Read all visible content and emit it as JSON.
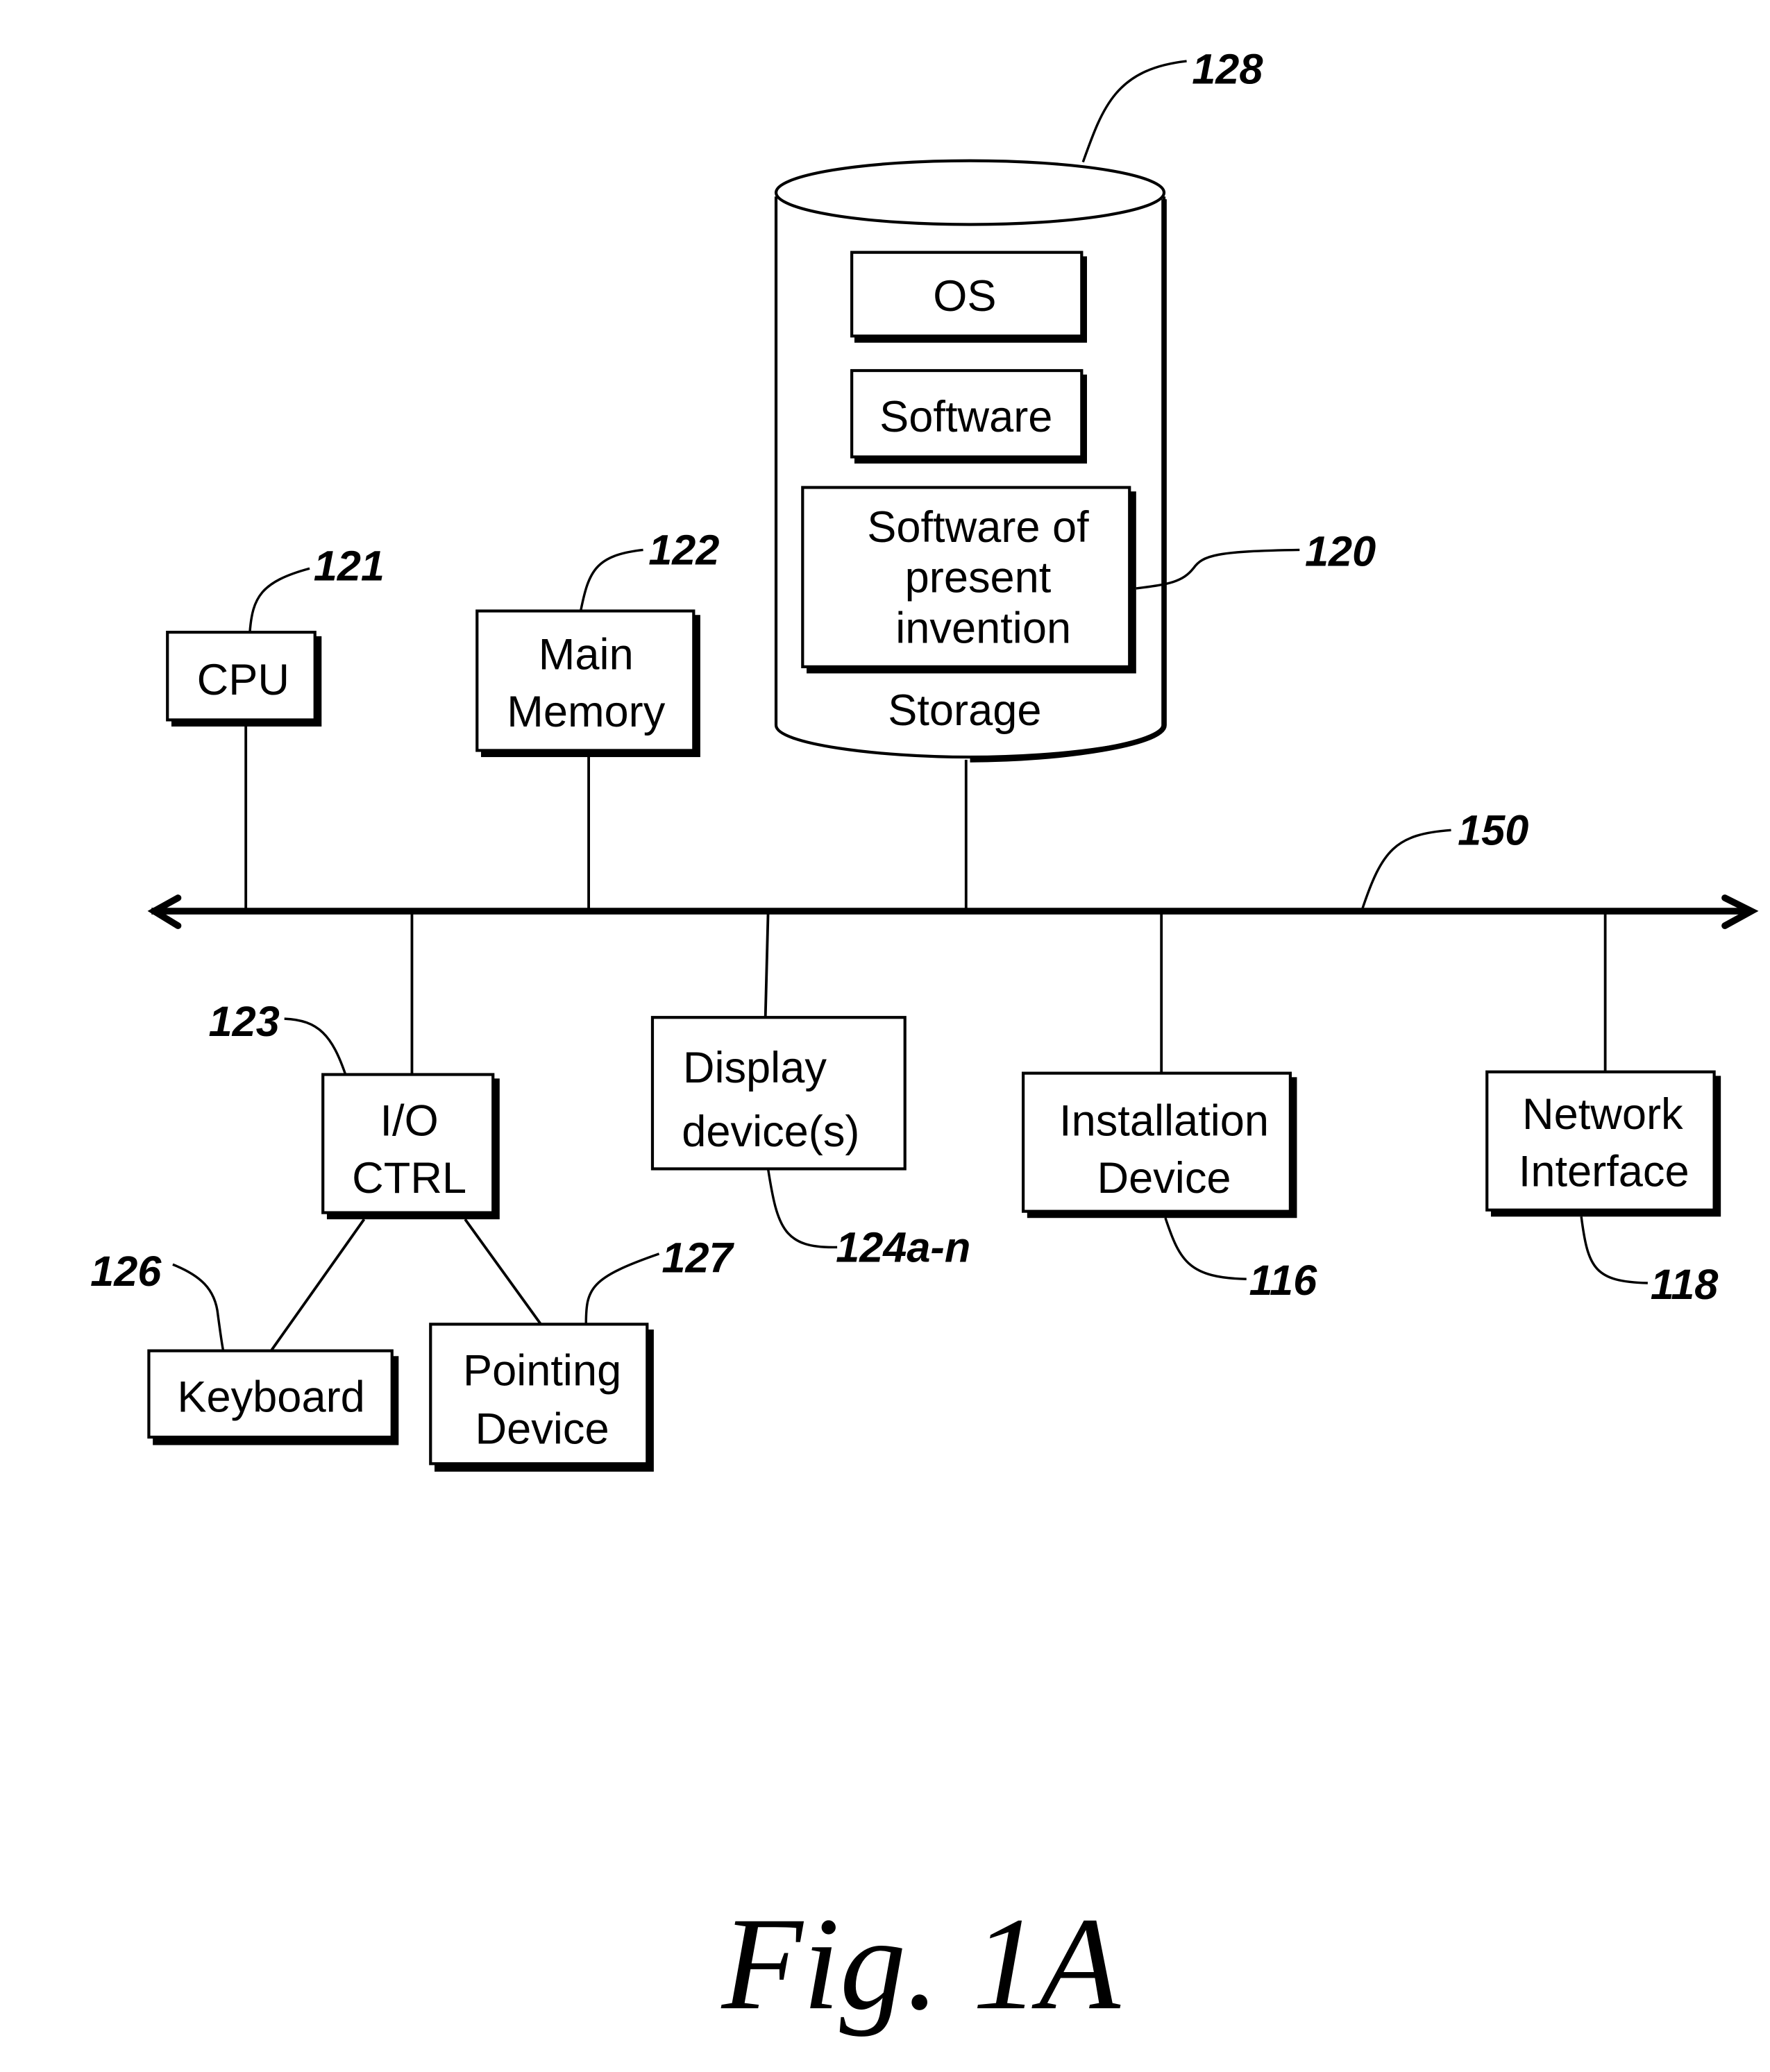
{
  "figure": {
    "caption": "Fig. 1A",
    "bus": {
      "ref": "150"
    },
    "storage": {
      "ref": "128",
      "label": "Storage",
      "contents": {
        "os": {
          "label": "OS"
        },
        "software": {
          "label": "Software"
        },
        "invention": {
          "ref": "120",
          "lines": [
            "Software of",
            "present",
            "invention"
          ]
        }
      }
    },
    "cpu": {
      "ref": "121",
      "lines": [
        "CPU"
      ]
    },
    "main_memory": {
      "ref": "122",
      "lines": [
        "Main",
        "Memory"
      ]
    },
    "io_ctrl": {
      "ref": "123",
      "lines": [
        "I/O",
        "CTRL"
      ]
    },
    "display": {
      "ref": "124a-n",
      "lines": [
        "Display",
        "device(s)"
      ]
    },
    "installation": {
      "ref": "116",
      "lines": [
        "Installation",
        "Device"
      ]
    },
    "network": {
      "ref": "118",
      "lines": [
        "Network",
        "Interface"
      ]
    },
    "keyboard": {
      "ref": "126",
      "lines": [
        "Keyboard"
      ]
    },
    "pointing": {
      "ref": "127",
      "lines": [
        "Pointing",
        "Device"
      ]
    }
  }
}
